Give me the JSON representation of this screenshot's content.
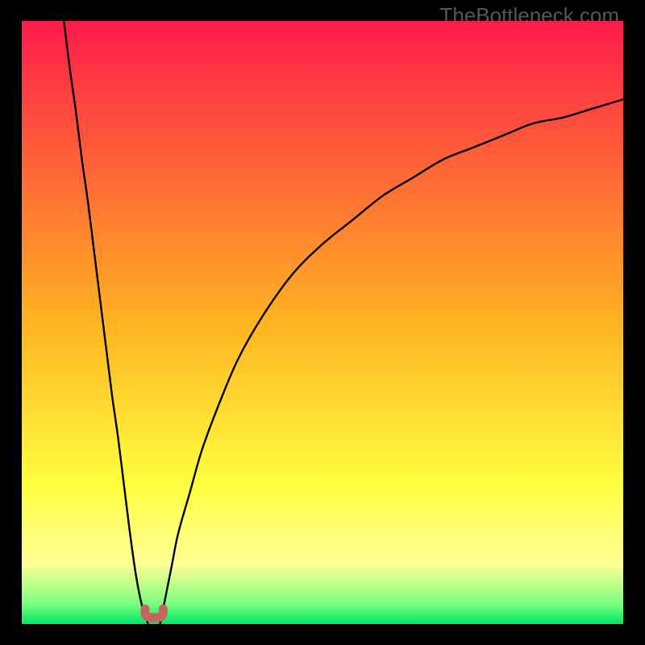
{
  "watermark": "TheBottleneck.com",
  "chart_data": {
    "type": "line",
    "title": "",
    "xlabel": "",
    "ylabel": "",
    "xlim": [
      0,
      100
    ],
    "ylim": [
      0,
      100
    ],
    "grid": false,
    "legend": false,
    "gradient_stops": [
      {
        "offset": 0.0,
        "color": "#ff1b4b"
      },
      {
        "offset": 0.5,
        "color": "#ffb321"
      },
      {
        "offset": 0.77,
        "color": "#ffff3f"
      },
      {
        "offset": 0.9,
        "color": "#ffff96"
      },
      {
        "offset": 0.965,
        "color": "#80ff80"
      },
      {
        "offset": 1.0,
        "color": "#00e765"
      }
    ],
    "series": [
      {
        "name": "left-branch",
        "x": [
          7,
          8,
          9,
          10,
          11,
          12,
          13,
          14,
          15,
          16,
          17,
          18,
          19,
          20,
          21
        ],
        "y": [
          100,
          92,
          85,
          77,
          70,
          62,
          54,
          46,
          38,
          31,
          23,
          15,
          8,
          3,
          0
        ]
      },
      {
        "name": "right-branch",
        "x": [
          23,
          24,
          25,
          26,
          28,
          30,
          33,
          36,
          40,
          45,
          50,
          55,
          60,
          65,
          70,
          75,
          80,
          85,
          90,
          95,
          100
        ],
        "y": [
          0,
          5,
          10,
          15,
          22,
          29,
          37,
          44,
          51,
          58,
          63,
          67,
          71,
          74,
          77,
          79,
          81,
          83,
          84,
          85.5,
          87
        ]
      }
    ],
    "marker": {
      "name": "min-point",
      "x_range": [
        20.5,
        23.5
      ],
      "y": 0.5,
      "shape": "u",
      "color": "#c8645f"
    }
  }
}
